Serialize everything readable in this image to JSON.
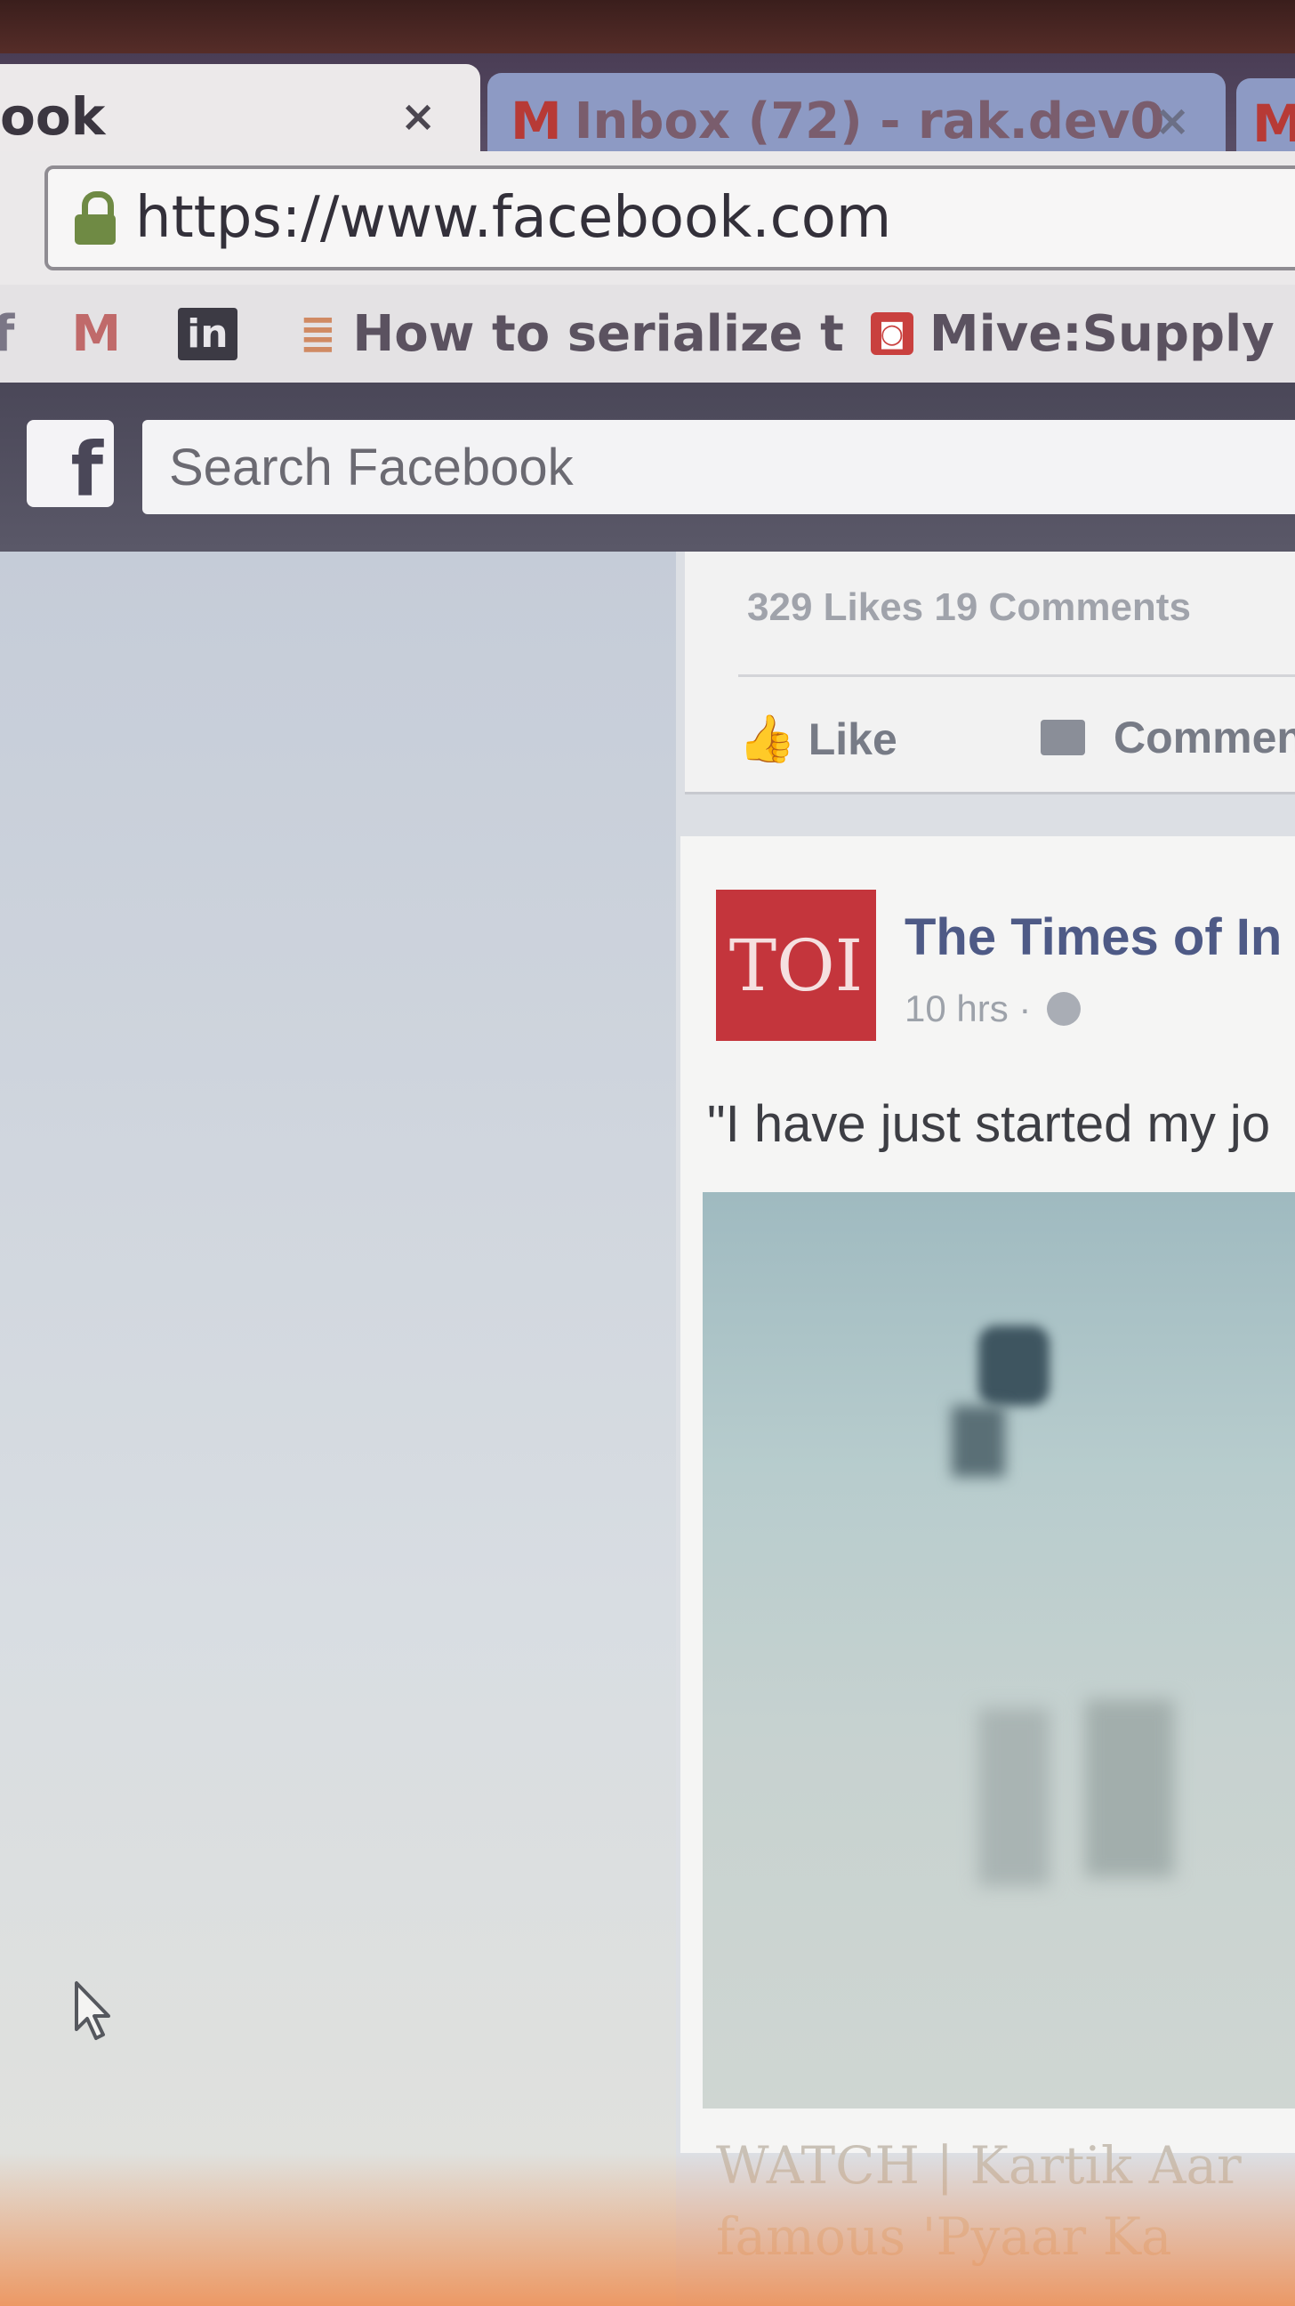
{
  "browser": {
    "tabs": [
      {
        "title": "ook",
        "active": true,
        "close": "×"
      },
      {
        "title": "Inbox (72) - rak.dev0",
        "active": false,
        "icon": "gmail-icon",
        "close": "×"
      }
    ],
    "url": "https://www.facebook.com",
    "bookmarks": [
      {
        "icon": "facebook-icon",
        "glyph": "f",
        "label": ""
      },
      {
        "icon": "gmail-icon",
        "glyph": "M",
        "label": ""
      },
      {
        "icon": "linkedin-icon",
        "glyph": "in",
        "label": ""
      },
      {
        "icon": "stackoverflow-icon",
        "glyph": "≣",
        "label": "How to serialize t"
      },
      {
        "icon": "mive-icon",
        "glyph": "◙",
        "label": "Mive:Supply"
      }
    ]
  },
  "facebook": {
    "logo": "f",
    "search_placeholder": "Search Facebook",
    "post1": {
      "stats": "329 Likes   19 Comments",
      "like_label": "Like",
      "comment_label": "Commen"
    },
    "post2": {
      "logo_text": "TOI",
      "page_name": "The Times of In",
      "time": "10 hrs ·",
      "text": "\"I have just started my jo",
      "caption_line1": "WATCH | Kartik Aar",
      "caption_line2": "famous 'Pyaar Ka"
    }
  },
  "colors": {
    "fb_blue": "#4e5a86",
    "toi_red": "#c4353c",
    "lock_green": "#6f8a44"
  }
}
